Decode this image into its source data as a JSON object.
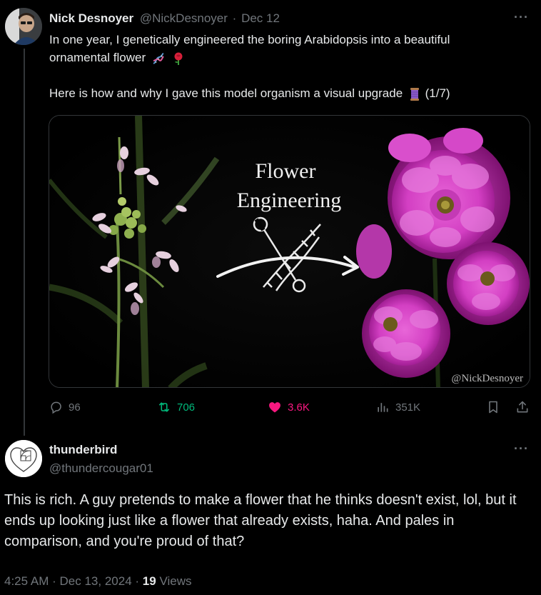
{
  "tweet": {
    "author_name": "Nick Desnoyer",
    "author_handle": "@NickDesnoyer",
    "separator": "·",
    "date": "Dec 12",
    "more": "···",
    "text_line1": "In one year, I genetically engineered the boring Arabidopsis into a beautiful",
    "text_line2": "ornamental flower",
    "text_line3": "Here is how and why I gave this model organism a visual upgrade",
    "thread_count": "(1/7)",
    "media": {
      "title_line1": "Flower",
      "title_line2": "Engineering",
      "watermark": "@NickDesnoyer"
    },
    "actions": {
      "replies": "96",
      "reposts": "706",
      "likes": "3.6K",
      "views": "351K"
    },
    "colors": {
      "repost": "#00ba7c",
      "like": "#f91880",
      "muted": "#71767b"
    }
  },
  "reply": {
    "author_name": "thunderbird",
    "author_handle": "@thundercougar01",
    "more": "···",
    "text": "This is rich. A guy pretends to make a flower that he thinks doesn't exist, lol, but it ends up looking just like a flower that already exists, haha. And pales in comparison, and you're proud of that?",
    "time": "4:25 AM",
    "separator": "·",
    "date": "Dec 13, 2024",
    "separator2": "·",
    "views_count": "19",
    "views_label": "Views"
  }
}
